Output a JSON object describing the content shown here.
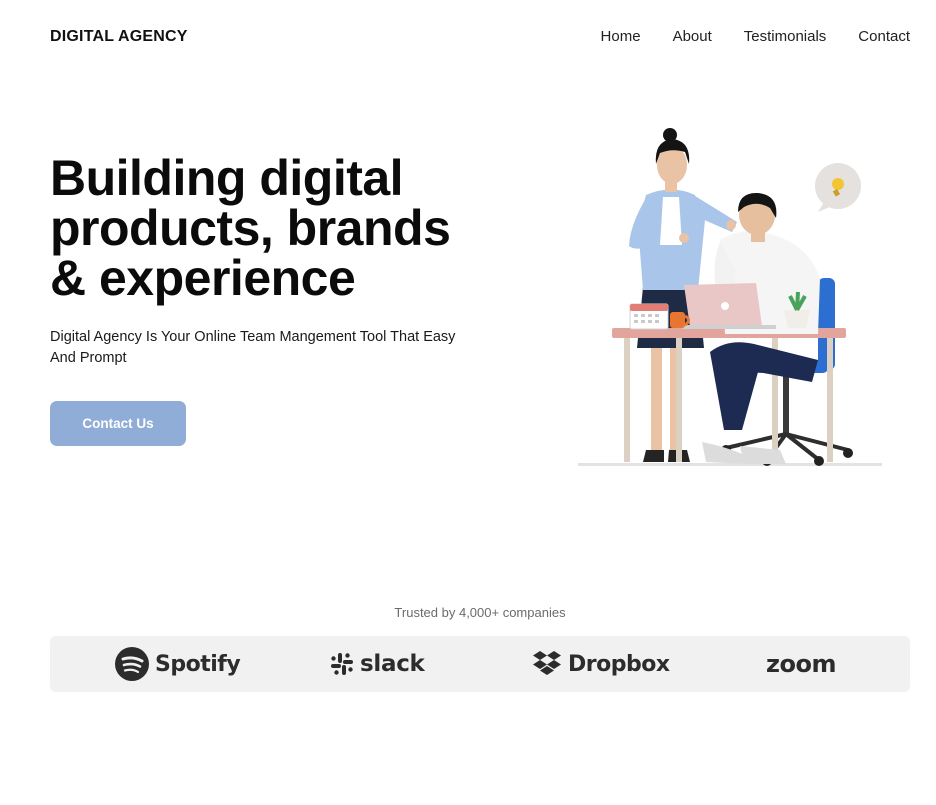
{
  "header": {
    "logo": "DIGITAL AGENCY",
    "nav": [
      {
        "label": "Home"
      },
      {
        "label": "About"
      },
      {
        "label": "Testimonials"
      },
      {
        "label": "Contact"
      }
    ]
  },
  "hero": {
    "title_lines": [
      "Building digital",
      "products, brands",
      "& experience"
    ],
    "subtitle": "Digital Agency Is Your Online Team Mangement Tool That Easy And Prompt",
    "cta_label": "Contact Us",
    "illustration": "two-people-at-desk-with-laptop"
  },
  "trusted": {
    "text": "Trusted by 4,000+ companies",
    "logos": [
      {
        "name": "Spotify",
        "icon": "spotify-icon"
      },
      {
        "name": "slack",
        "icon": "slack-icon"
      },
      {
        "name": "Dropbox",
        "icon": "dropbox-icon"
      },
      {
        "name": "zoom",
        "icon": ""
      }
    ]
  },
  "colors": {
    "cta_bg": "#8fadd6",
    "logo_strip_bg": "#f1f1f1",
    "text_dark": "#0b0b0b",
    "muted": "#6b6b6b"
  }
}
